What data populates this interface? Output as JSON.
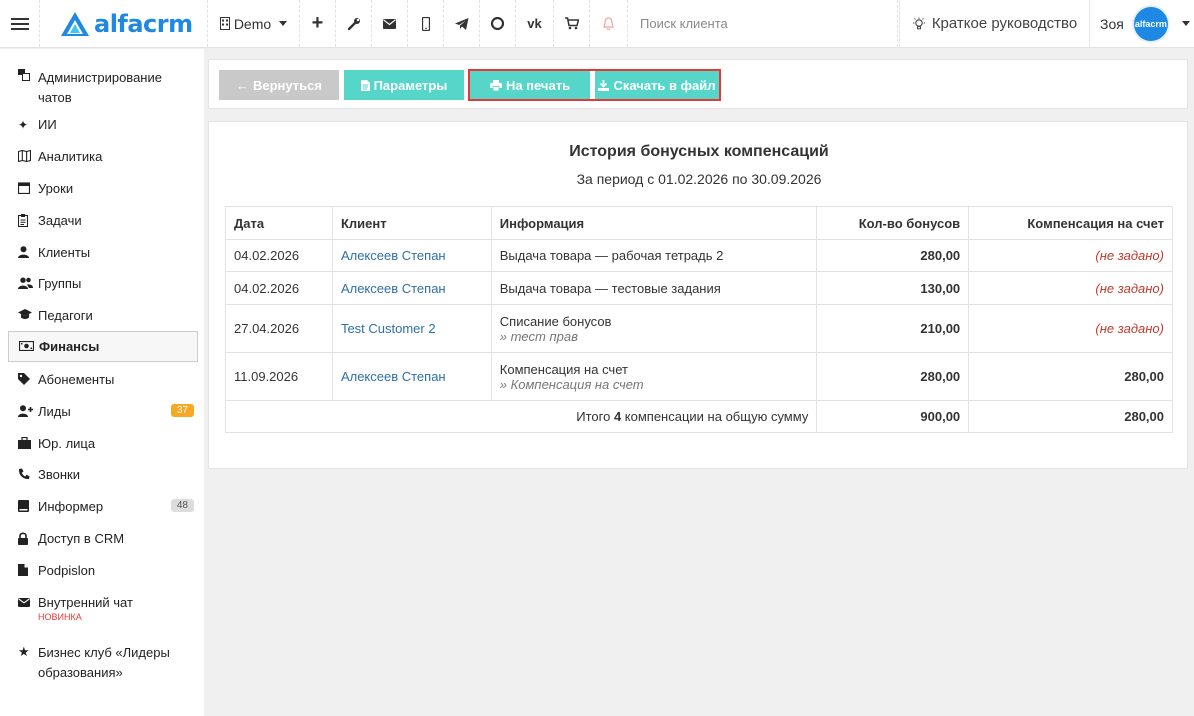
{
  "topbar": {
    "logo": "alfacrm",
    "branch": "Demo",
    "search_placeholder": "Поиск клиента",
    "guide": "Краткое руководство",
    "user_name": "Зоя",
    "avatar_label": "alfacrm"
  },
  "sidebar": {
    "items": [
      {
        "label": "Администрирование чатов",
        "icon": "chats-icon"
      },
      {
        "label": "ИИ",
        "icon": "sparkle-icon"
      },
      {
        "label": "Аналитика",
        "icon": "map-icon"
      },
      {
        "label": "Уроки",
        "icon": "calendar-icon"
      },
      {
        "label": "Задачи",
        "icon": "clipboard-icon"
      },
      {
        "label": "Клиенты",
        "icon": "user-icon"
      },
      {
        "label": "Группы",
        "icon": "users-icon"
      },
      {
        "label": "Педагоги",
        "icon": "graduation-cap-icon"
      },
      {
        "label": "Финансы",
        "icon": "money-icon"
      },
      {
        "label": "Абонементы",
        "icon": "tag-icon"
      },
      {
        "label": "Лиды",
        "icon": "user-plus-icon",
        "badge": "37"
      },
      {
        "label": "Юр. лица",
        "icon": "briefcase-icon"
      },
      {
        "label": "Звонки",
        "icon": "phone-icon"
      },
      {
        "label": "Информер",
        "icon": "book-icon",
        "badge": "48"
      },
      {
        "label": "Доступ в CRM",
        "icon": "lock-icon"
      },
      {
        "label": "Podpislon",
        "icon": "file-icon"
      },
      {
        "label": "Внутренний чат",
        "icon": "envelope-icon",
        "tag": "НОВИНКА"
      },
      {
        "label": "Бизнес клуб «Лидеры образования»",
        "icon": "star-icon"
      }
    ]
  },
  "toolbar": {
    "back": "Вернуться",
    "params": "Параметры",
    "print": "На печать",
    "download": "Скачать в файл"
  },
  "report": {
    "title": "История бонусных компенсаций",
    "subtitle": "За период с 01.02.2026 по 30.09.2026",
    "columns": [
      "Дата",
      "Клиент",
      "Информация",
      "Кол-во бонусов",
      "Компенсация на счет"
    ],
    "rows": [
      {
        "date": "04.02.2026",
        "client": "Алексеев Степан",
        "info": "Выдача товара — рабочая тетрадь 2",
        "note": "",
        "bonus": "280,00",
        "comp": "(не задано)"
      },
      {
        "date": "04.02.2026",
        "client": "Алексеев Степан",
        "info": "Выдача товара — тестовые задания",
        "note": "",
        "bonus": "130,00",
        "comp": "(не задано)"
      },
      {
        "date": "27.04.2026",
        "client": "Test Customer 2",
        "info": "Списание бонусов",
        "note": "» тест прав",
        "bonus": "210,00",
        "comp": "(не задано)"
      },
      {
        "date": "11.09.2026",
        "client": "Алексеев Степан",
        "info": "Компенсация на счет",
        "note": "» Компенсация на счет",
        "bonus": "280,00",
        "comp": "280,00"
      }
    ],
    "total_prefix": "Итого ",
    "total_count": "4",
    "total_suffix": " компенсации на общую сумму",
    "total_bonus": "900,00",
    "total_comp": "280,00"
  },
  "colors": {
    "accent": "#55d6c8",
    "brand": "#1e88e5",
    "highlight": "#e53935"
  }
}
